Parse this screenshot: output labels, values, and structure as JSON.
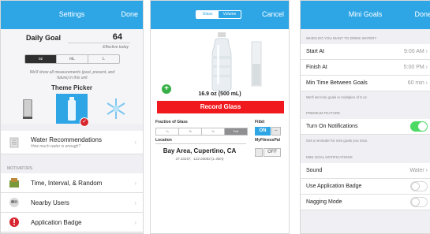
{
  "settings_screen": {
    "title": "Settings",
    "done": "Done",
    "daily_goal": {
      "label": "Daily Goal",
      "value": "64",
      "note": "Effective today"
    },
    "units": {
      "options": [
        "oz",
        "mL",
        "L"
      ],
      "selected": "oz"
    },
    "units_note": "We'll show all measurements (past, present, and future) in this unit",
    "theme_picker": {
      "title": "Theme Picker",
      "selected_index": 1
    },
    "water_recommendations": {
      "label": "Water Recommendations",
      "sub": "How much water is enough?"
    },
    "motivators_header": "MOTIVATORS",
    "motivators": [
      {
        "label": "Time, Interval, & Random",
        "icon": "clock-icon"
      },
      {
        "label": "Nearby Users",
        "icon": "users-icon"
      },
      {
        "label": "Application Badge",
        "icon": "badge-icon"
      }
    ]
  },
  "record_screen": {
    "tabs": [
      "Glass",
      "Volume"
    ],
    "selected_tab": "Glass",
    "cancel": "Cancel",
    "bottle_size": "16.9 oz (500 mL)",
    "record_button": "Record Glass",
    "fraction": {
      "label": "Fraction of Glass",
      "options": [
        "¼",
        "½",
        "¾",
        "Full"
      ],
      "selected": "Full"
    },
    "fitbit": {
      "label": "Fitbit",
      "state": "ON"
    },
    "location": {
      "label": "Location",
      "city": "Bay Area, Cupertino, CA",
      "coords": "37.33157, -122.03063 (± 30m)"
    },
    "myfitnesspal": {
      "label": "MyFitnessPal",
      "state": "OFF"
    }
  },
  "mini_goals_screen": {
    "title": "Mini Goals",
    "done": "Done",
    "section_when": "WHEN DO YOU WANT TO DRINK WATER?",
    "start_at": {
      "label": "Start At",
      "value": "9:00 AM"
    },
    "finish_at": {
      "label": "Finish At",
      "value": "5:00 PM"
    },
    "min_time": {
      "label": "Min Time Between Goals",
      "value": "60 min"
    },
    "multiples_note": "We'll set mini goals in multiples of 8 oz.",
    "section_premium": "PREMIUM FEATURE",
    "notifications": {
      "label": "Turn On Notifications",
      "on": true
    },
    "notifications_note": "Get a reminder for mini goals you miss.",
    "section_mini_notif": "MINI GOAL NOTIFICATIONS",
    "sound": {
      "label": "Sound",
      "value": "Water"
    },
    "use_badge": {
      "label": "Use Application Badge",
      "on": false
    },
    "nagging": {
      "label": "Nagging Mode",
      "on": false
    }
  },
  "colors": {
    "nav_blue": "#2ea6e6",
    "record_red": "#f0191e",
    "toggle_green": "#4cd964",
    "badge_red": "#d7262f"
  }
}
